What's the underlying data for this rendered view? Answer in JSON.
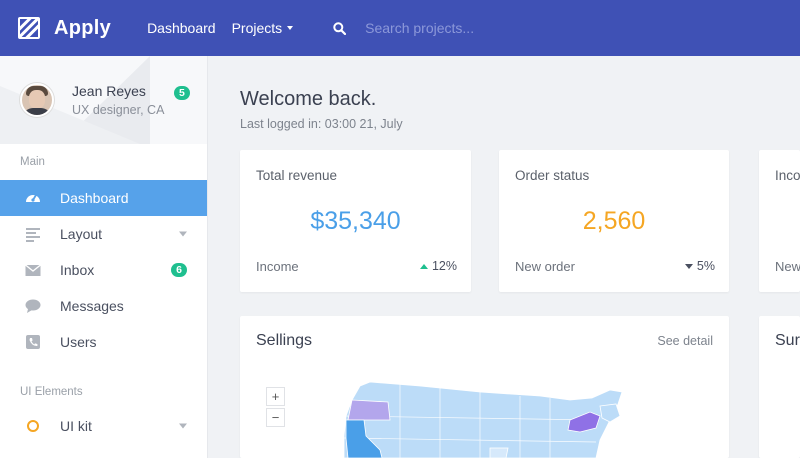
{
  "app": {
    "name": "Apply"
  },
  "nav": {
    "dashboard": "Dashboard",
    "projects": "Projects"
  },
  "search": {
    "placeholder": "Search projects..."
  },
  "profile": {
    "name": "Jean Reyes",
    "role": "UX designer, CA",
    "badge": "5"
  },
  "sidebar": {
    "sections": [
      {
        "label": "Main"
      },
      {
        "label": "UI Elements"
      }
    ],
    "items": [
      {
        "label": "Dashboard",
        "icon": "dashboard-icon",
        "active": true
      },
      {
        "label": "Layout",
        "icon": "layout-icon",
        "dropdown": true
      },
      {
        "label": "Inbox",
        "icon": "mail-icon",
        "badge": "6"
      },
      {
        "label": "Messages",
        "icon": "chat-icon"
      },
      {
        "label": "Users",
        "icon": "phone-icon"
      },
      {
        "label": "UI kit",
        "icon": "circle-icon",
        "dropdown": true
      }
    ]
  },
  "main": {
    "welcome": "Welcome back.",
    "last_login": "Last logged in: 03:00 21, July"
  },
  "cards": [
    {
      "title": "Total revenue",
      "value": "$35,340",
      "value_color": "#4a9fe8",
      "foot": "Income",
      "delta": "12%",
      "trend": "up"
    },
    {
      "title": "Order status",
      "value": "2,560",
      "value_color": "#f5a623",
      "foot": "New order",
      "delta": "5%",
      "trend": "down"
    },
    {
      "title": "Inco",
      "foot": "New"
    }
  ],
  "sellings": {
    "title": "Sellings",
    "see_detail": "See detail",
    "zoom_in": "+",
    "zoom_out": "−"
  },
  "side_card": {
    "title": "Sur"
  },
  "colors": {
    "topbar": "#3f51b5",
    "active": "#56a2ea",
    "badge": "#1fbf8f",
    "map_base": "#bcdcf8",
    "map_purple": "#8f71e6",
    "map_lavender": "#b3a6ec",
    "map_blue": "#4a9fe8"
  }
}
